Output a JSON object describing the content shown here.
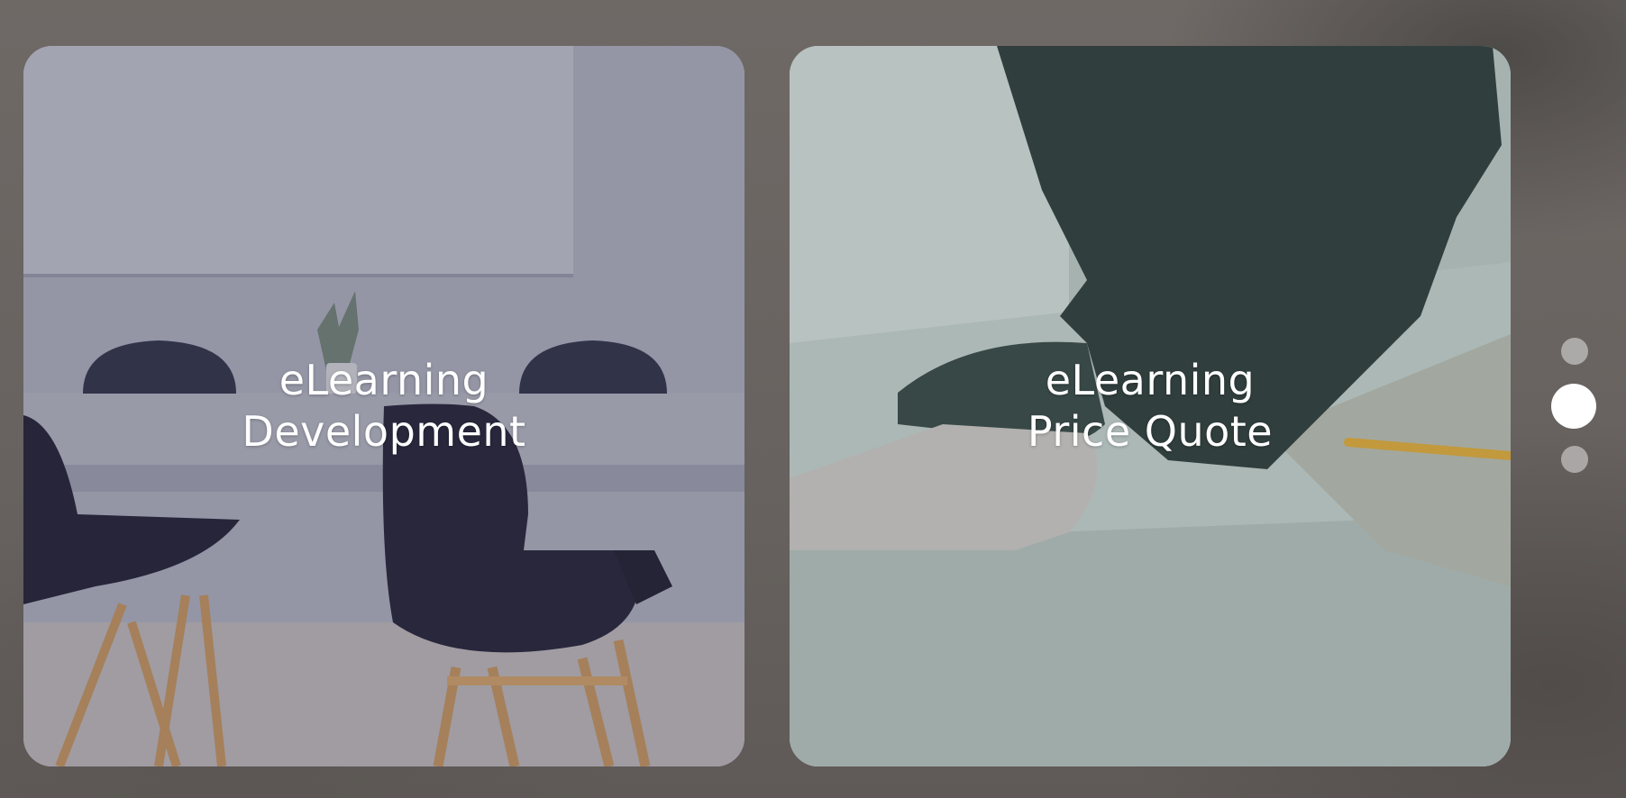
{
  "cards": [
    {
      "title_line1": "eLearning",
      "title_line2": "Development",
      "image": "meeting-room-chairs-image"
    },
    {
      "title_line1": "eLearning",
      "title_line2": "Price Quote",
      "image": "person-writing-desk-image"
    }
  ],
  "pagination": {
    "total": 3,
    "active_index": 2
  },
  "colors": {
    "background": "#6c6663",
    "text": "#ffffff",
    "dot_active": "#ffffff",
    "dot_inactive": "#bfbcbb"
  }
}
